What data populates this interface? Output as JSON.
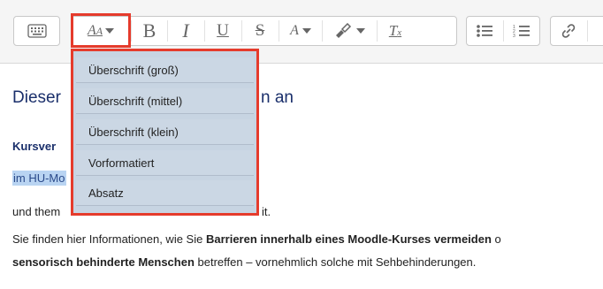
{
  "toolbar": {
    "buttons": {
      "toggle": "toolbar-toggle-icon",
      "heading": "A",
      "bold": "B",
      "italic": "I",
      "underline": "U",
      "strike": "S",
      "fontcolor": "A",
      "backcolor": "backcolor-icon",
      "clearformat": "T",
      "bullets": "bullet-list-icon",
      "numbers": "numbered-list-icon",
      "link": "link-icon"
    }
  },
  "dropdown": {
    "items": [
      "Überschrift (groß)",
      "Überschrift (mittel)",
      "Überschrift (klein)",
      "Vorformatiert",
      "Absatz"
    ]
  },
  "content": {
    "heading_left": "Dieser",
    "heading_right": "n an",
    "kurs": "Kursver",
    "hu": "im HU-Mo",
    "undthem": "und them",
    "it": "it.",
    "para_line1_a": "Sie finden hier Informationen, wie Sie ",
    "para_line1_b": "Barrieren innerhalb eines Moodle-Kurses vermeiden",
    "para_line1_c": " o",
    "para_line2_a": "sensorisch behinderte Menschen",
    "para_line2_b": " betreffen – vornehmlich solche mit Sehbehinderungen."
  },
  "colors": {
    "accent_border": "#e53b2c",
    "dropdown_bg": "#cbd7e4",
    "heading": "#1a2f6b",
    "selection": "#b9d4f2"
  }
}
